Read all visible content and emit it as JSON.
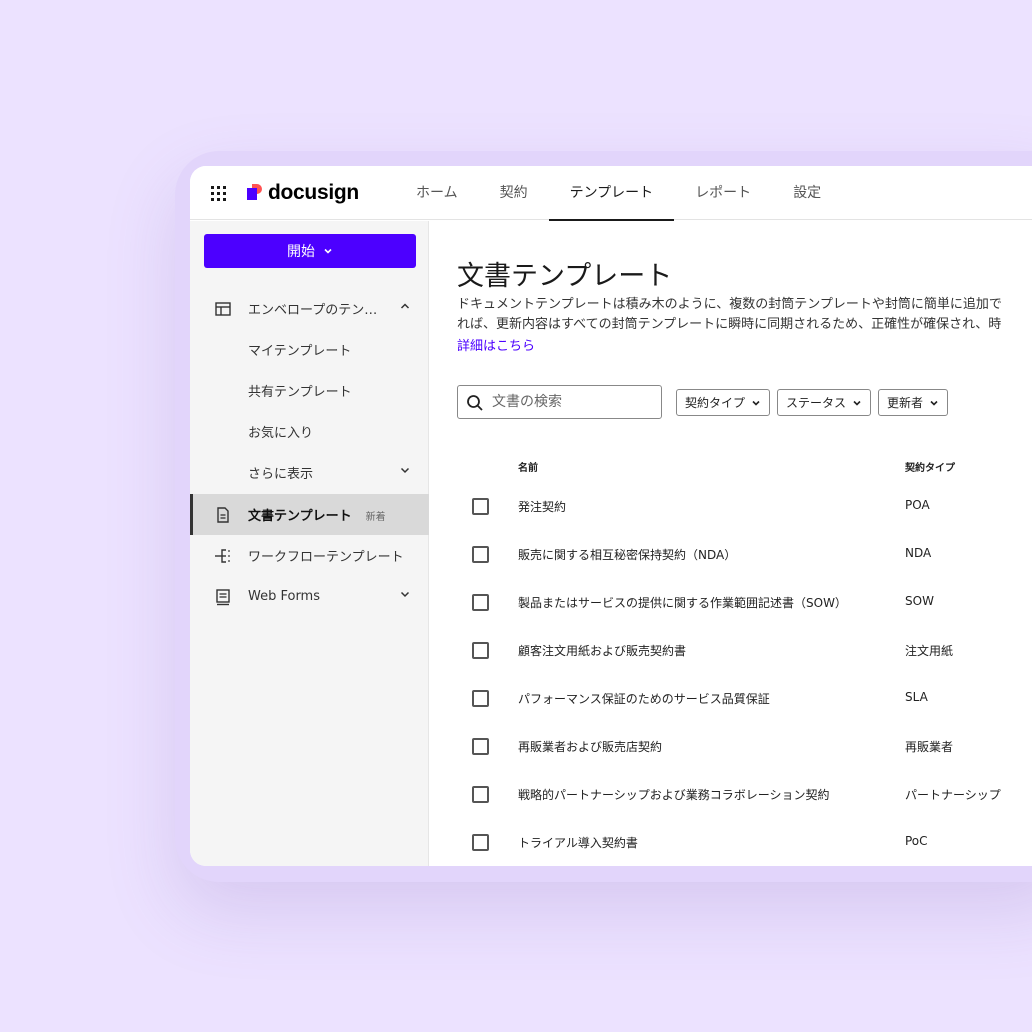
{
  "nav": {
    "brand": "docusign",
    "tabs": [
      {
        "label": "ホーム"
      },
      {
        "label": "契約"
      },
      {
        "label": "テンプレート"
      },
      {
        "label": "レポート"
      },
      {
        "label": "設定"
      }
    ],
    "active_tab": "テンプレート"
  },
  "sidebar": {
    "start_label": "開始",
    "items": [
      {
        "label": "エンベロープのテン…",
        "icon": "layout-icon",
        "chevron": "chevron-up"
      },
      {
        "label": "マイテンプレート"
      },
      {
        "label": "共有テンプレート"
      },
      {
        "label": "お気に入り"
      },
      {
        "label": "さらに表示",
        "chevron": "chevron-down"
      },
      {
        "label": "文書テンプレート",
        "badge": "新着",
        "icon": "document-icon",
        "active": true
      },
      {
        "label": "ワークフローテンプレート",
        "icon": "workflow-icon"
      },
      {
        "label": "Web Forms",
        "icon": "webforms-icon",
        "chevron": "chevron-down"
      }
    ]
  },
  "main": {
    "title": "文書テンプレート",
    "description_line1": "ドキュメントテンプレートは積み木のように、複数の封筒テンプレートや封筒に簡単に追加で",
    "description_line2": "れば、更新内容はすべての封筒テンプレートに瞬時に同期されるため、正確性が確保され、時",
    "more_link": "詳細はこちら",
    "search_placeholder": "文書の検索",
    "filters": [
      {
        "label": "契約タイプ"
      },
      {
        "label": "ステータス"
      },
      {
        "label": "更新者"
      }
    ],
    "columns": {
      "name": "名前",
      "type": "契約タイプ"
    },
    "rows": [
      {
        "name": "発注契約",
        "type": "POA"
      },
      {
        "name": "販売に関する相互秘密保持契約（NDA）",
        "type": "NDA"
      },
      {
        "name": "製品またはサービスの提供に関する作業範囲記述書（SOW）",
        "type": "SOW"
      },
      {
        "name": "顧客注文用紙および販売契約書",
        "type": "注文用紙"
      },
      {
        "name": "パフォーマンス保証のためのサービス品質保証",
        "type": "SLA"
      },
      {
        "name": "再販業者および販売店契約",
        "type": "再販業者"
      },
      {
        "name": "戦略的パートナーシップおよび業務コラボレーション契約",
        "type": "パートナーシップ"
      },
      {
        "name": "トライアル導入契約書",
        "type": "PoC"
      }
    ]
  },
  "colors": {
    "background": "#ece2ff",
    "frame": "#e2d5fb",
    "accent": "#4c00ff",
    "logo_accent": "#ff5252"
  }
}
